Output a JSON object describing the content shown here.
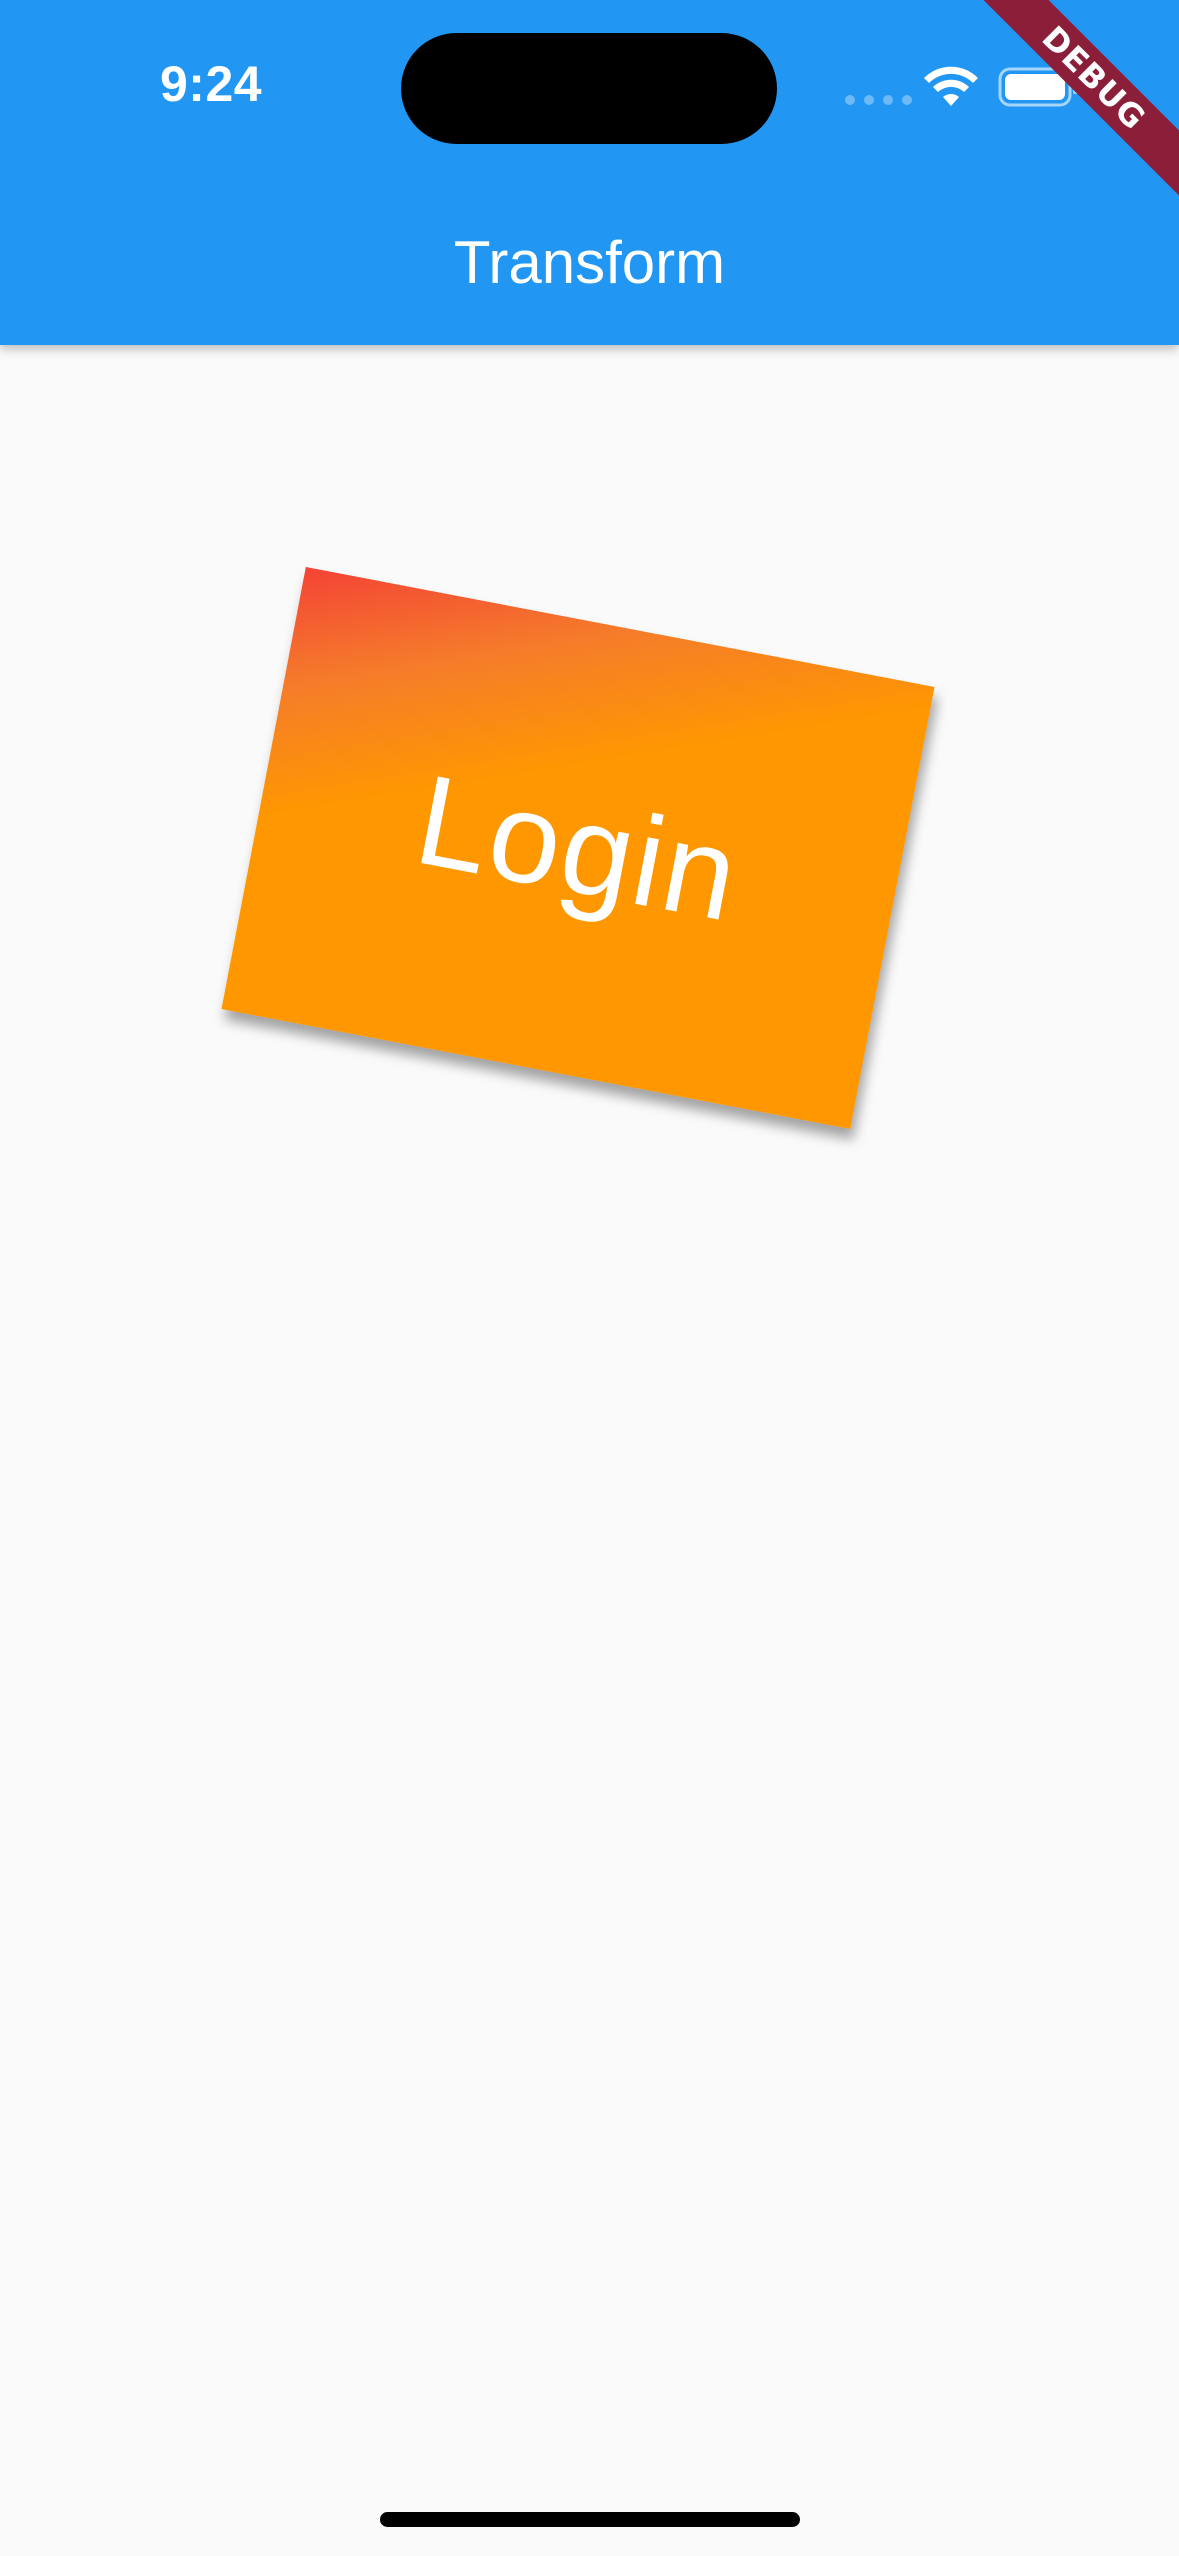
{
  "status_bar": {
    "time": "9:24",
    "icons": [
      "cellular-signal-icon",
      "wifi-icon",
      "battery-icon"
    ]
  },
  "debug_banner": {
    "label": "DEBUG",
    "color": "#8b1f3a"
  },
  "app_bar": {
    "title": "Transform",
    "color": "#2196f3"
  },
  "card": {
    "label": "Login",
    "gradient_colors": [
      "#f44336",
      "#ff9800"
    ],
    "rotation_deg": 10.8
  },
  "colors": {
    "background": "#fafafa",
    "text_on_primary": "#ffffff"
  }
}
